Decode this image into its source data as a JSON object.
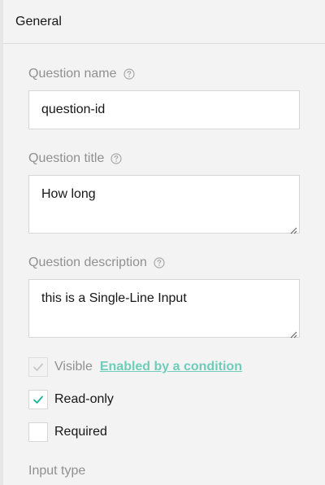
{
  "section": {
    "title": "General"
  },
  "question_name": {
    "label": "Question name",
    "value": "question-id",
    "help_icon": "help-circle-icon"
  },
  "question_title": {
    "label": "Question title",
    "value": "How long",
    "help_icon": "help-circle-icon"
  },
  "question_description": {
    "label": "Question description",
    "value": "this is a Single-Line Input",
    "help_icon": "help-circle-icon"
  },
  "visible": {
    "label": "Visible",
    "checked": true,
    "disabled": true,
    "link": "Enabled by a condition"
  },
  "read_only": {
    "label": "Read-only",
    "checked": true
  },
  "required": {
    "label": "Required",
    "checked": false
  },
  "input_type": {
    "label": "Input type"
  },
  "colors": {
    "accent": "#19b394",
    "label_gray": "#909090",
    "border": "#d6d6d6",
    "background": "#f3f3f3"
  }
}
